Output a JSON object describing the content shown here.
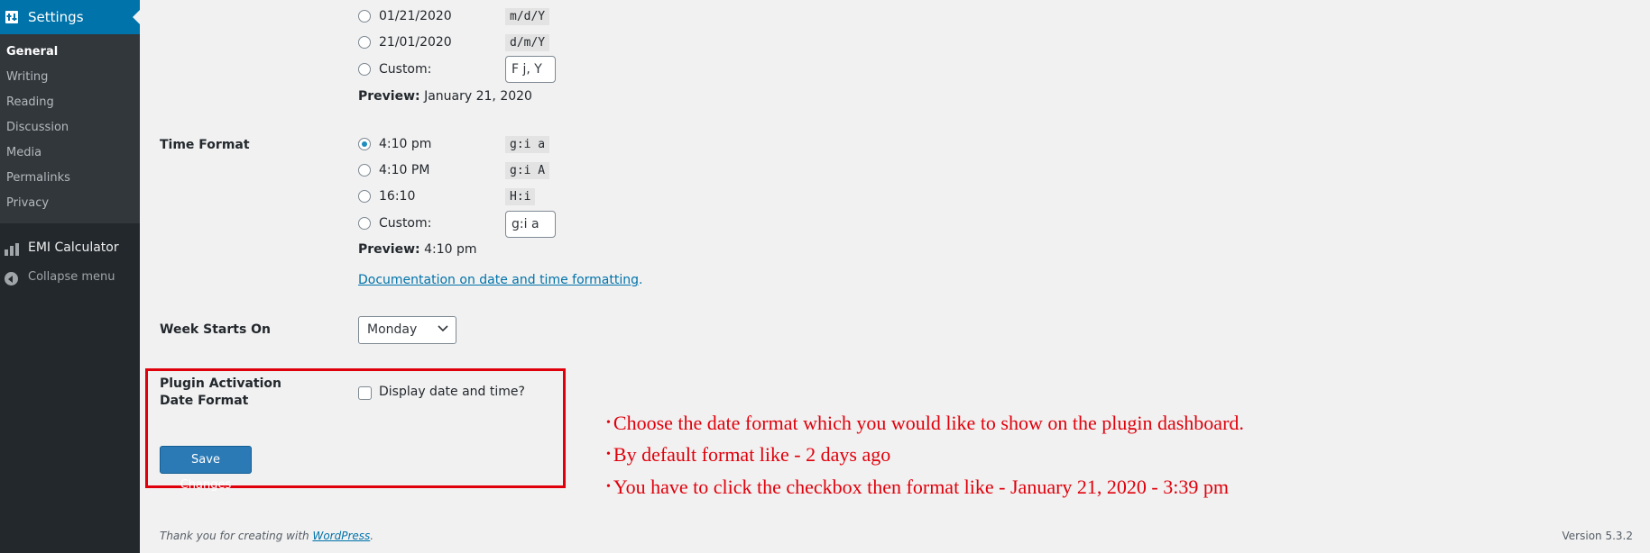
{
  "sidebar": {
    "settings_label": "Settings",
    "submenu": [
      "General",
      "Writing",
      "Reading",
      "Discussion",
      "Media",
      "Permalinks",
      "Privacy"
    ],
    "emi_label": "EMI Calculator",
    "collapse_label": "Collapse menu"
  },
  "date_format": {
    "options": [
      {
        "label": "01/21/2020",
        "code": "m/d/Y"
      },
      {
        "label": "21/01/2020",
        "code": "d/m/Y"
      },
      {
        "label": "Custom:",
        "value": "F j, Y"
      }
    ],
    "preview_label": "Preview:",
    "preview_value": "January 21, 2020"
  },
  "time_format": {
    "label": "Time Format",
    "options": [
      {
        "label": "4:10 pm",
        "code": "g:i a",
        "checked": true
      },
      {
        "label": "4:10 PM",
        "code": "g:i A"
      },
      {
        "label": "16:10",
        "code": "H:i"
      },
      {
        "label": "Custom:",
        "value": "g:i a"
      }
    ],
    "preview_label": "Preview:",
    "preview_value": "4:10 pm",
    "doc_link": "Documentation on date and time formatting",
    "doc_link_suffix": "."
  },
  "week_starts": {
    "label": "Week Starts On",
    "value": "Monday"
  },
  "plugin_date": {
    "label": "Plugin Activation Date Format",
    "checkbox_label": "Display date and time?",
    "checked": false
  },
  "save_label": "Save Changes",
  "annotation": {
    "color": "#e0000b",
    "lines": [
      "Choose the date format which you would like to show on the plugin dashboard.",
      "By default format like - 2 days ago",
      "You have to click the checkbox then format like - January 21, 2020 - 3:39 pm"
    ]
  },
  "footer": {
    "thanks_prefix": "Thank you for creating with ",
    "wordpress_link": "WordPress",
    "thanks_suffix": ".",
    "version": "Version 5.3.2"
  },
  "colors": {
    "sidebar_bg": "#23282d",
    "accent": "#0073aa",
    "button": "#2c7ab5"
  }
}
